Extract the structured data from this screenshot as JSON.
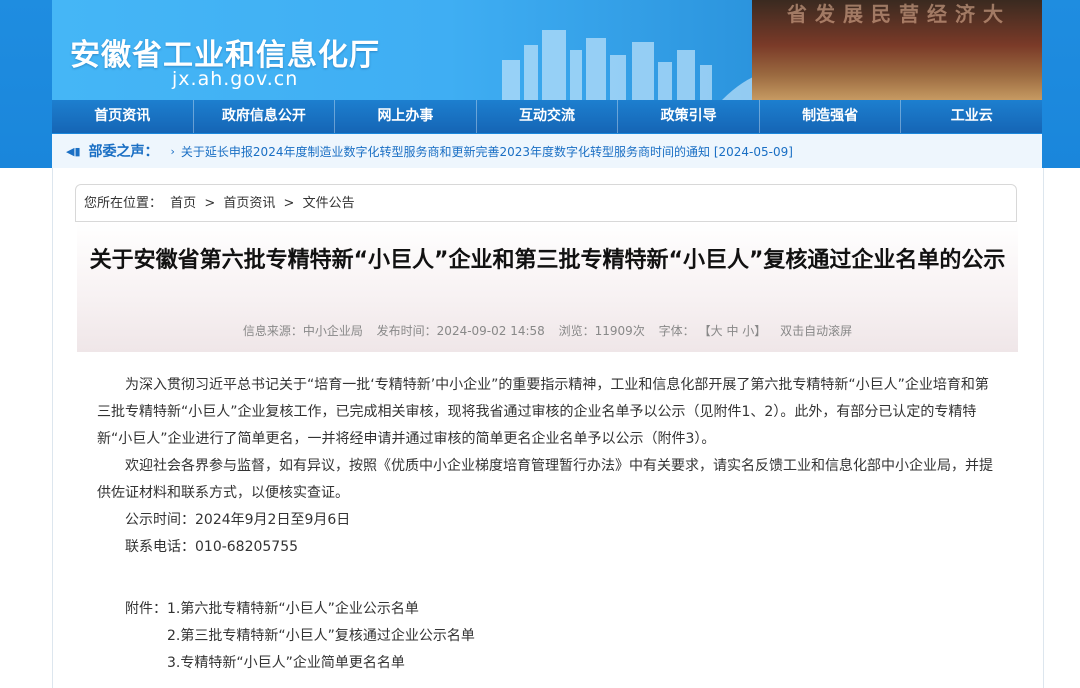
{
  "header": {
    "site_title": "安徽省工业和信息化厅",
    "site_url": "jx.ah.gov.cn",
    "banner_photo_text": "省发展民营经济大"
  },
  "nav": {
    "items": [
      "首页资讯",
      "政府信息公开",
      "网上办事",
      "互动交流",
      "政策引导",
      "制造强省",
      "工业云"
    ]
  },
  "notice": {
    "label": "部委之声：",
    "text": "关于延长申报2024年度制造业数字化转型服务商和更新完善2023年度数字化转型服务商时间的通知 [2024-05-09]"
  },
  "breadcrumb": {
    "prefix": "您所在位置：",
    "items": [
      "首页",
      "首页资讯",
      "文件公告"
    ],
    "separator": ">"
  },
  "article": {
    "title": "关于安徽省第六批专精特新“小巨人”企业和第三批专精特新“小巨人”复核通过企业名单的公示",
    "meta": {
      "source": "信息来源：中小企业局",
      "time": "发布时间：2024-09-02 14:58",
      "views": "浏览：11909次",
      "font_label": "字体：",
      "font_sizes": "【大 中 小】",
      "scroll": "双击自动滚屏"
    },
    "paragraphs": [
      "为深入贯彻习近平总书记关于“培育一批‘专精特新’中小企业”的重要指示精神，工业和信息化部开展了第六批专精特新“小巨人”企业培育和第三批专精特新“小巨人”企业复核工作，已完成相关审核，现将我省通过审核的企业名单予以公示（见附件1、2）。此外，有部分已认定的专精特新“小巨人”企业进行了简单更名，一并将经申请并通过审核的简单更名企业名单予以公示（附件3）。",
      "欢迎社会各界参与监督，如有异议，按照《优质中小企业梯度培育管理暂行办法》中有关要求，请实名反馈工业和信息化部中小企业局，并提供佐证材料和联系方式，以便核实查证。",
      "公示时间：2024年9月2日至9月6日",
      "联系电话：010-68205755"
    ],
    "attachments_label": "附件：",
    "attachments": [
      "1.第六批专精特新“小巨人”企业公示名单",
      "2.第三批专精特新“小巨人”复核通过企业公示名单",
      "3.专精特新“小巨人”企业简单更名名单"
    ]
  }
}
